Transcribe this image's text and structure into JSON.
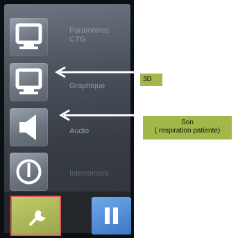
{
  "menu": {
    "items": [
      {
        "label_line1": "Paramètres",
        "label_line2": "CTG",
        "icon": "monitor-icon"
      },
      {
        "label": "Graphique",
        "icon": "monitor-icon"
      },
      {
        "label": "Audio",
        "icon": "speaker-icon"
      },
      {
        "label": "Interrompre",
        "icon": "power-icon"
      }
    ]
  },
  "bottom_bar": {
    "settings_icon": "wrench-icon",
    "pause_icon": "pause-icon"
  },
  "annotations": {
    "graphique_callout": "3D",
    "audio_callout_line1": "Son",
    "audio_callout_line2": "( respiration patiente)"
  },
  "colors": {
    "callout_bg": "#a3b84a",
    "highlight_border": "#e05b5b",
    "pause_button": "#4f8ad6",
    "settings_button": "#aab656"
  }
}
